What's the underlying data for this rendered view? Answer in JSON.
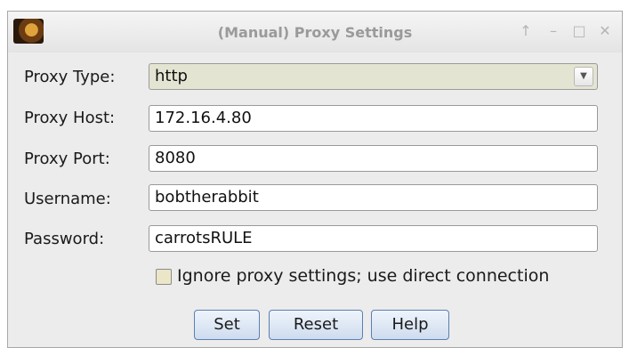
{
  "window": {
    "title": "(Manual) Proxy Settings",
    "controls": {
      "up": "↑",
      "minimize": "–",
      "maximize": "□",
      "close": "✕"
    }
  },
  "form": {
    "proxy_type": {
      "label": "Proxy Type:",
      "value": "http"
    },
    "proxy_host": {
      "label": "Proxy Host:",
      "value": "172.16.4.80"
    },
    "proxy_port": {
      "label": "Proxy Port:",
      "value": "8080"
    },
    "username": {
      "label": "Username:",
      "value": "bobtherabbit"
    },
    "password": {
      "label": "Password:",
      "value": "carrotsRULE"
    }
  },
  "ignore_proxy": {
    "label": "Ignore proxy settings; use direct connection",
    "checked": false
  },
  "buttons": {
    "set": "Set",
    "reset": "Reset",
    "help": "Help"
  },
  "colors": {
    "button_border": "#5b7fb0",
    "select_bg": "#e4e4d2",
    "window_bg": "#ececec"
  }
}
